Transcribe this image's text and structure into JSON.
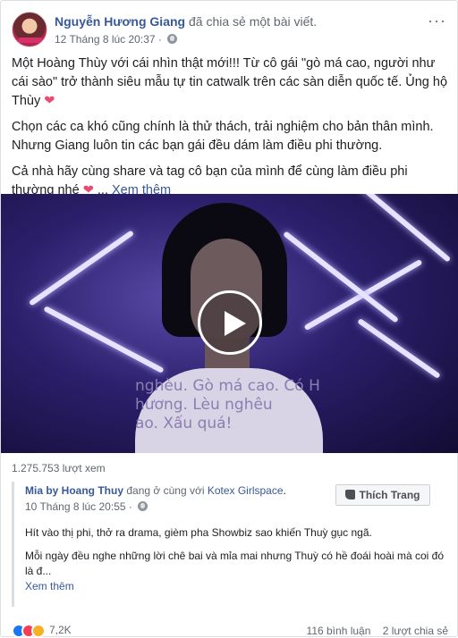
{
  "post": {
    "author": "Nguyễn Hương Giang",
    "action": "đã chia sẻ một bài viết.",
    "timestamp": "12 Tháng 8 lúc 20:37 ·",
    "more_icon": "···",
    "paragraphs": [
      "Một Hoàng Thùy với cái nhìn thật mới!!! Từ cô gái \"gò má cao, người như cái sào\" trở thành siêu mẫu tự tin catwalk trên các sàn diễn quốc tế. Ủng hộ Thùy",
      "Chọn các ca khó cũng chính là thử thách, trải nghiệm cho bản thân mình. Nhưng Giang luôn tin các bạn gái đều dám làm điều phi thường.",
      "Cả nhà hãy cùng share và tag cô bạn của mình để cùng làm điều phi thường nhé"
    ],
    "heart": "❤",
    "ellipsis": "...",
    "see_more": "Xem thêm",
    "video": {
      "projected_text": [
        "nghèu. Gò má cao. Có H",
        "hương. Lèu nghêu",
        "ao. Xấu quá!"
      ]
    },
    "views": "1.275.753 lượt xem"
  },
  "shared": {
    "author": "Mia by Hoang Thuy",
    "with": "đang ở cùng với",
    "place": "Kotex Girlspace",
    "period": ".",
    "timestamp": "10 Tháng 8 lúc 20:55 ·",
    "like_page": "Thích Trang",
    "paragraphs": [
      "Hít vào thị phi, thở ra drama, gièm pha Showbiz sao khiến Thuỳ gục ngã.",
      "Mỗi ngày đều nghe những lời chê bai và mỉa mai nhưng Thuỳ có hề đoái hoài mà coi đó là đ..."
    ],
    "see_more": "Xem thêm"
  },
  "footer": {
    "reaction_count": "7,2K",
    "comments": "116 bình luận",
    "shares": "2 lượt chia sẻ"
  },
  "colors": {
    "link": "#385898",
    "secondary": "#616770",
    "love": "#e84a71"
  }
}
